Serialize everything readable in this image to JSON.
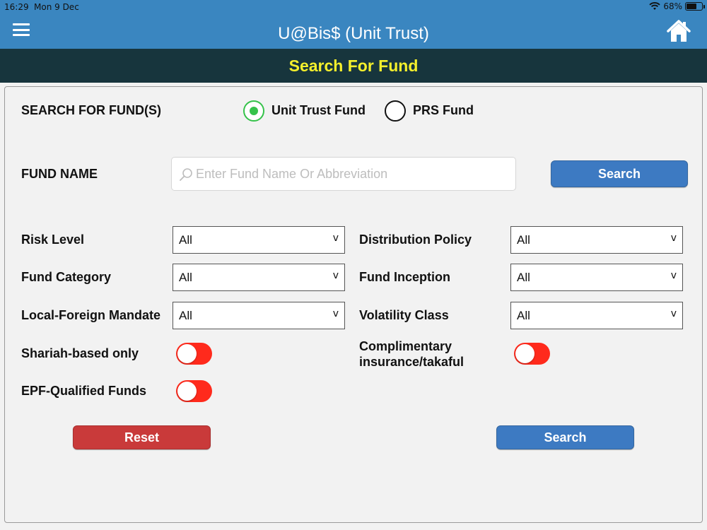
{
  "status_bar": {
    "time": "16:29",
    "date": "Mon 9 Dec",
    "battery": "68%",
    "battery_level": 0.68,
    "wifi_icon": "wifi-icon"
  },
  "header": {
    "title": "U@Bis$ (Unit Trust)",
    "menu_icon": "hamburger-menu-icon",
    "home_icon": "home-icon",
    "color": "#3a86c0"
  },
  "subheader": {
    "title": "Search For Fund",
    "background": "#17353d",
    "text_color": "#f5f02c"
  },
  "fund_type": {
    "label": "SEARCH FOR FUND(S)",
    "options": [
      {
        "label": "Unit Trust Fund",
        "selected": true
      },
      {
        "label": "PRS Fund",
        "selected": false
      }
    ]
  },
  "fund_name": {
    "label": "FUND NAME",
    "placeholder": "Enter Fund Name Or Abbreviation",
    "value": "",
    "search_label": "Search"
  },
  "filters": {
    "risk_level": {
      "label": "Risk Level",
      "value": "All"
    },
    "fund_category": {
      "label": "Fund Category",
      "value": "All"
    },
    "local_foreign_mandate": {
      "label": "Local-Foreign Mandate",
      "value": "All"
    },
    "distribution_policy": {
      "label": "Distribution Policy",
      "value": "All"
    },
    "fund_inception": {
      "label": "Fund Inception",
      "value": "All"
    },
    "volatility_class": {
      "label": "Volatility Class",
      "value": "All"
    },
    "chevron": "v"
  },
  "toggles": {
    "shariah": {
      "label": "Shariah-based only",
      "on": false
    },
    "epf": {
      "label": "EPF-Qualified Funds",
      "on": false
    },
    "insurance": {
      "label_line1": "Complimentary",
      "label_line2": "insurance/takaful",
      "on": false
    },
    "color": "#ff2a1c"
  },
  "actions": {
    "reset_label": "Reset",
    "search_label": "Search",
    "reset_color": "#c93a3a",
    "search_color": "#3d7ac2"
  }
}
